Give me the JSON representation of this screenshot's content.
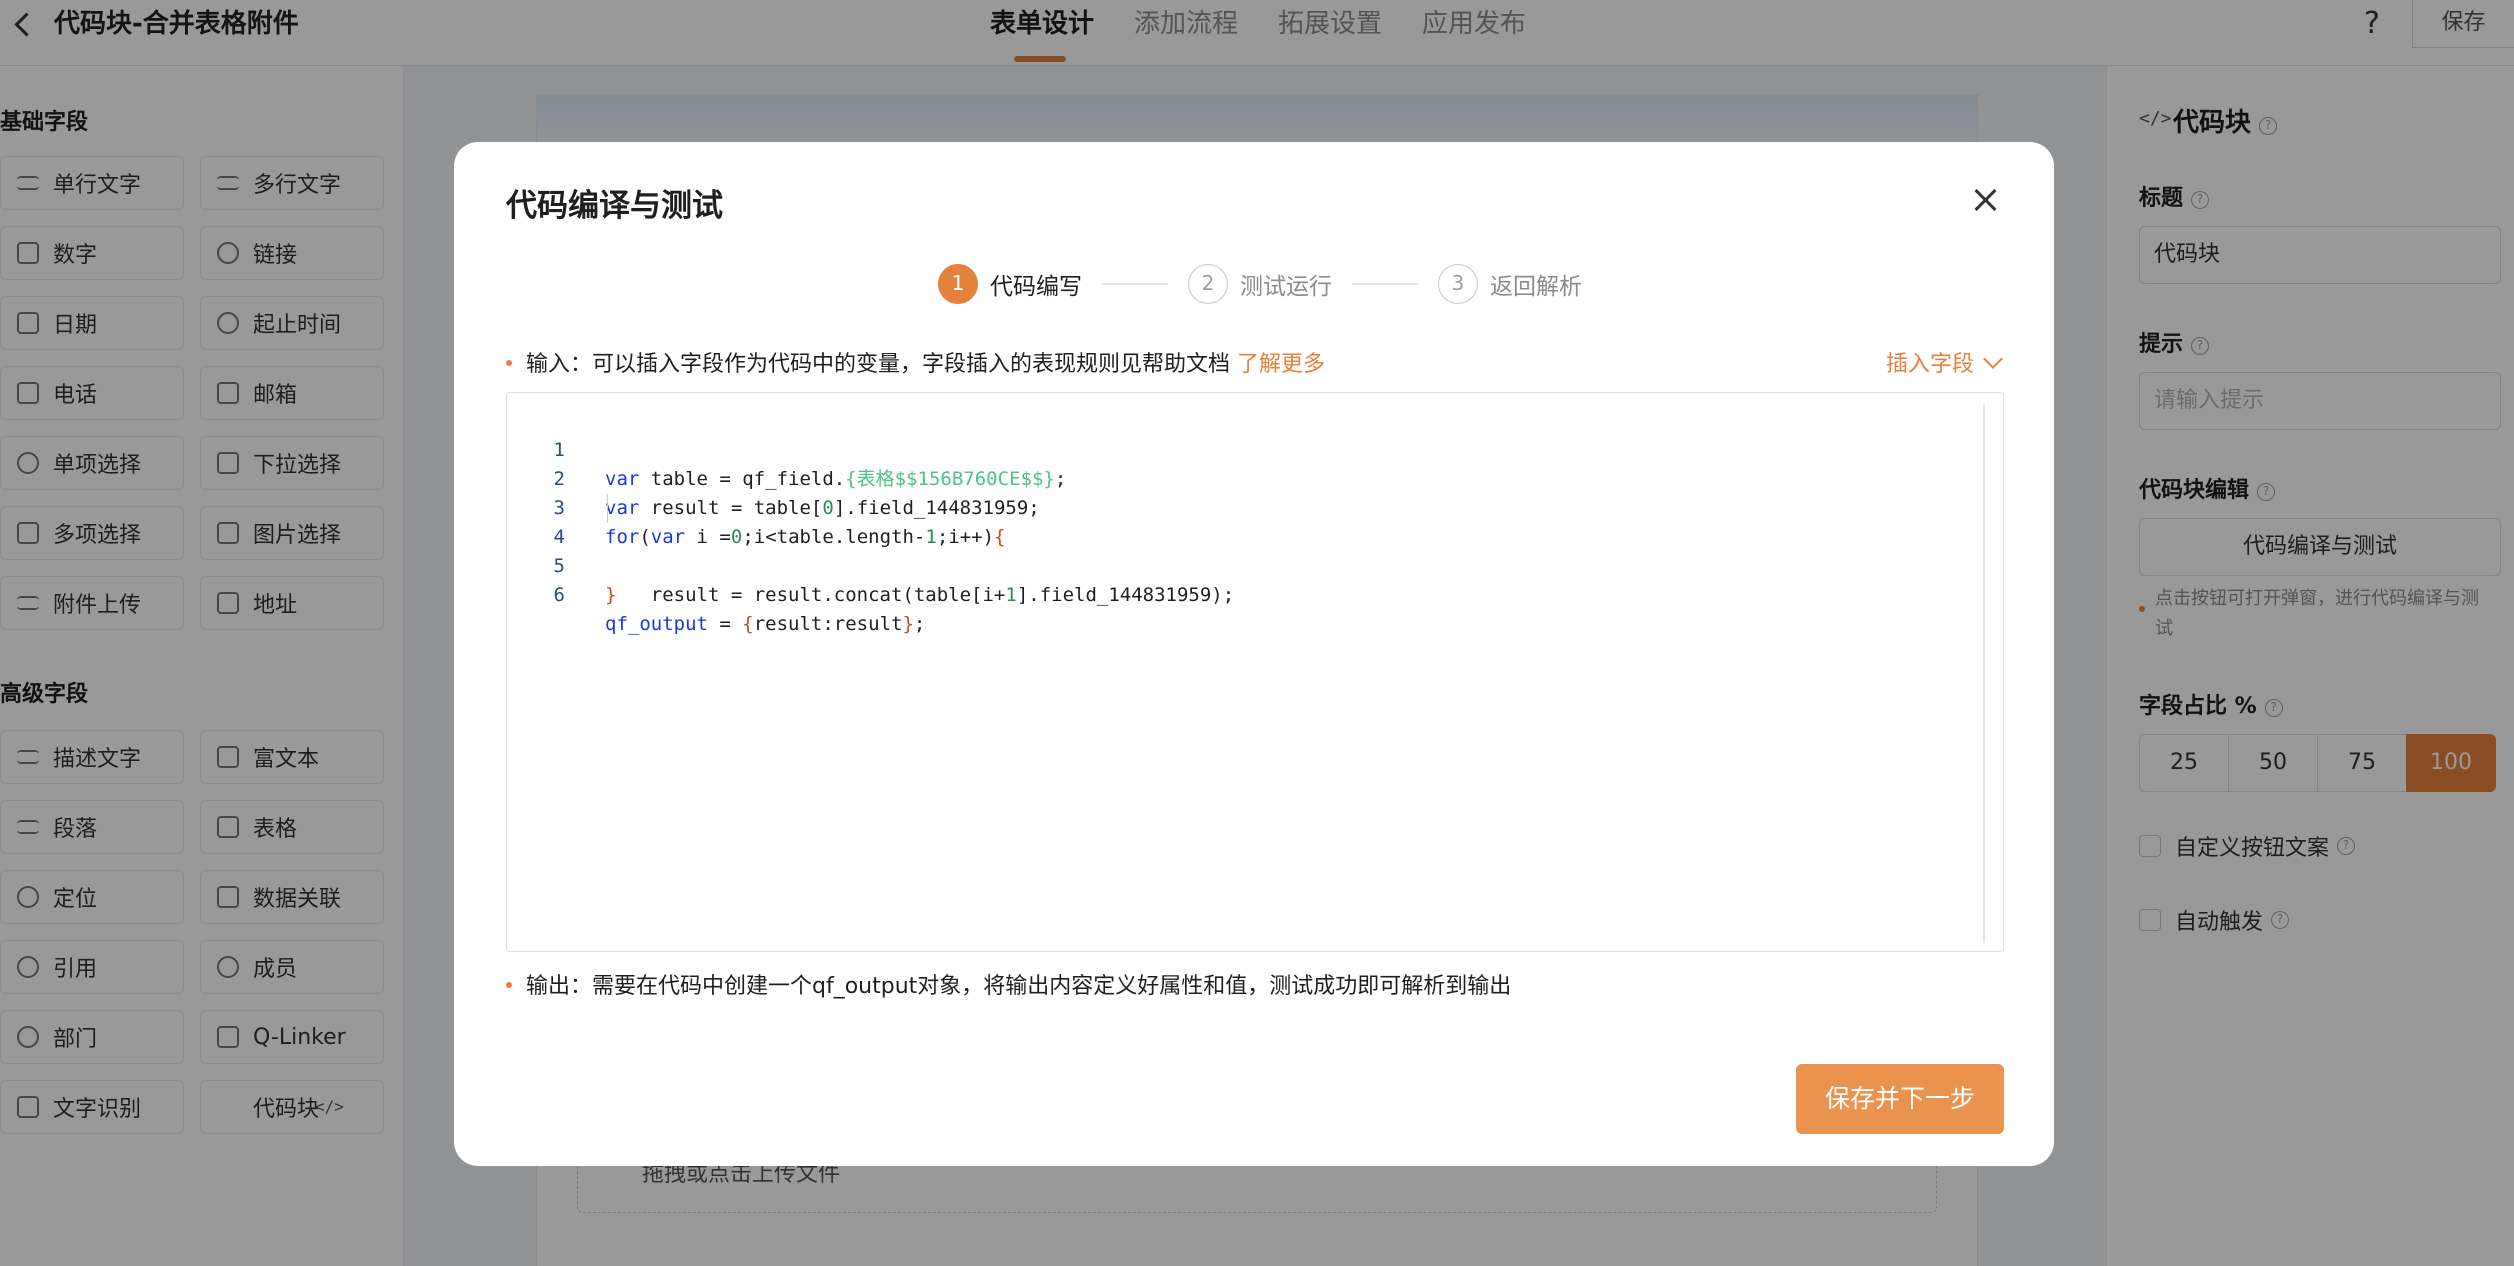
{
  "header": {
    "title": "代码块-合并表格附件",
    "tabs": [
      {
        "label": "表单设计"
      },
      {
        "label": "添加流程"
      },
      {
        "label": "拓展设置"
      },
      {
        "label": "应用发布"
      }
    ],
    "help": "?",
    "save": "保存"
  },
  "left": {
    "basic_title": "基础字段",
    "basic": [
      "单行文字",
      "多行文字",
      "数字",
      "链接",
      "日期",
      "起止时间",
      "电话",
      "邮箱",
      "单项选择",
      "下拉选择",
      "多项选择",
      "图片选择",
      "附件上传",
      "地址"
    ],
    "advanced_title": "高级字段",
    "advanced": [
      "描述文字",
      "富文本",
      "段落",
      "表格",
      "定位",
      "数据关联",
      "引用",
      "成员",
      "部门",
      "Q-Linker",
      "文字识别",
      "代码块"
    ]
  },
  "canvas": {
    "upload_label": "拖拽或点击上传文件"
  },
  "right": {
    "title": "代码块",
    "title_label": "标题",
    "title_value": "代码块",
    "hint_label": "提示",
    "hint_placeholder": "请输入提示",
    "editor_label": "代码块编辑",
    "editor_button": "代码编译与测试",
    "note": "点击按钮可打开弹窗，进行代码编译与测试",
    "ratio_label": "字段占比 %",
    "ratios": [
      "25",
      "50",
      "75",
      "100"
    ],
    "ratio_selected": "100",
    "custom_button_text": "自定义按钮文案",
    "auto_trigger": "自动触发"
  },
  "modal": {
    "title": "代码编译与测试",
    "steps": [
      {
        "num": "1",
        "label": "代码编写"
      },
      {
        "num": "2",
        "label": "测试运行"
      },
      {
        "num": "3",
        "label": "返回解析"
      }
    ],
    "active_step": 1,
    "input_hint": "输入：可以插入字段作为代码中的变量，字段插入的表现规则见帮助文档",
    "learn_more": "了解更多",
    "insert_field": "插入字段",
    "line_numbers": [
      "1",
      "2",
      "3",
      "4",
      "5",
      "6"
    ],
    "code": {
      "l1_kw": "var",
      "l1_a": " table = qf_field.",
      "l1_str": "{表格$$156B760CE$$}",
      "l1_b": ";",
      "l2_kw": "var",
      "l2_a": " result = table[",
      "l2_num": "0",
      "l2_b": "].field_144831959;",
      "l3_kw": "for",
      "l3_a": "(",
      "l3_kw2": "var",
      "l3_b": " i =",
      "l3_num": "0",
      "l3_c": ";i<table.length-",
      "l3_num2": "1",
      "l3_d": ";i++)",
      "l3_br": "{",
      "l4_a": "    result = result.concat(table[i+",
      "l4_num": "1",
      "l4_b": "].field_144831959);",
      "l5_br": "}",
      "l6_var": "qf_output",
      "l6_a": " = ",
      "l6_br": "{",
      "l6_b": "result:result",
      "l6_br2": "}",
      "l6_c": ";"
    },
    "output_hint": "输出：需要在代码中创建一个qf_output对象，将输出内容定义好属性和值，测试成功即可解析到输出",
    "next_button": "保存并下一步"
  },
  "colors": {
    "accent": "#e4813b",
    "next_button": "#e9934f",
    "keyword": "#1b39d9",
    "string": "#4cc38a"
  }
}
